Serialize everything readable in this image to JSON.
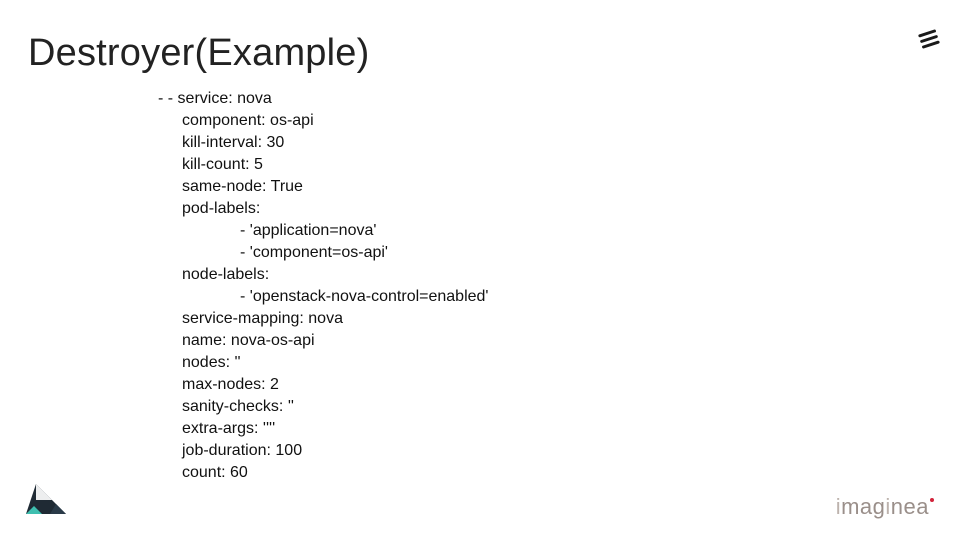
{
  "title": "Destroyer(Example)",
  "code": {
    "lines": [
      {
        "indent": 0,
        "text": "- - service: nova"
      },
      {
        "indent": 1,
        "text": "component: os-api"
      },
      {
        "indent": 1,
        "text": "kill-interval: 30"
      },
      {
        "indent": 1,
        "text": "kill-count: 5"
      },
      {
        "indent": 1,
        "text": "same-node: True"
      },
      {
        "indent": 1,
        "text": "pod-labels:"
      },
      {
        "indent": 2,
        "text": "- 'application=nova'"
      },
      {
        "indent": 2,
        "text": "- 'component=os-api'"
      },
      {
        "indent": 1,
        "text": "node-labels:"
      },
      {
        "indent": 2,
        "text": "- 'openstack-nova-control=enabled'"
      },
      {
        "indent": 1,
        "text": "service-mapping: nova"
      },
      {
        "indent": 1,
        "text": "name: nova-os-api"
      },
      {
        "indent": 1,
        "text": "nodes: ''"
      },
      {
        "indent": 1,
        "text": "max-nodes: 2"
      },
      {
        "indent": 1,
        "text": "sanity-checks: ''"
      },
      {
        "indent": 1,
        "text": "extra-args: ''''"
      },
      {
        "indent": 1,
        "text": "job-duration: 100"
      },
      {
        "indent": 1,
        "text": "count: 60"
      }
    ]
  },
  "brand": {
    "bottom_right": "imaginea"
  }
}
